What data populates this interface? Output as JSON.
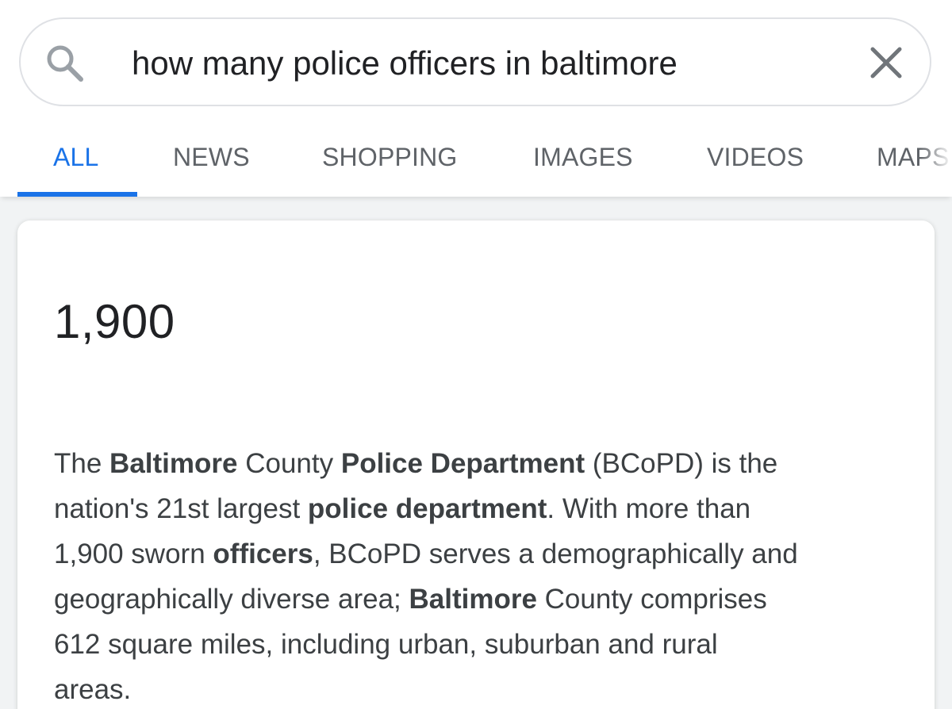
{
  "search": {
    "query": "how many police officers in baltimore",
    "search_icon": "search-icon",
    "clear_icon": "close-icon"
  },
  "tabs": [
    {
      "label": "ALL",
      "active": true
    },
    {
      "label": "NEWS",
      "active": false
    },
    {
      "label": "SHOPPING",
      "active": false
    },
    {
      "label": "IMAGES",
      "active": false
    },
    {
      "label": "VIDEOS",
      "active": false
    },
    {
      "label": "MAPS",
      "active": false
    }
  ],
  "answer_card": {
    "answer": "1,900",
    "snippet_lines": [
      [
        {
          "text": "The ",
          "bold": false
        },
        {
          "text": "Baltimore",
          "bold": true
        },
        {
          "text": " County ",
          "bold": false
        },
        {
          "text": "Police Department",
          "bold": true
        },
        {
          "text": " (BCoPD) is the",
          "bold": false
        }
      ],
      [
        {
          "text": "nation's 21st largest ",
          "bold": false
        },
        {
          "text": "police department",
          "bold": true
        },
        {
          "text": ". With more than",
          "bold": false
        }
      ],
      [
        {
          "text": "1,900 sworn ",
          "bold": false
        },
        {
          "text": "officers",
          "bold": true
        },
        {
          "text": ", BCoPD serves a demographically and",
          "bold": false
        }
      ],
      [
        {
          "text": "geographically diverse area; ",
          "bold": false
        },
        {
          "text": "Baltimore",
          "bold": true
        },
        {
          "text": " County comprises",
          "bold": false
        }
      ],
      [
        {
          "text": "612 square miles, including urban, suburban and rural",
          "bold": false
        }
      ],
      [
        {
          "text": "areas.",
          "bold": false
        }
      ]
    ]
  },
  "colors": {
    "accent": "#1a73e8",
    "tab_text": "#5f6368",
    "body_text": "#3c4043",
    "background": "#f1f3f4"
  }
}
